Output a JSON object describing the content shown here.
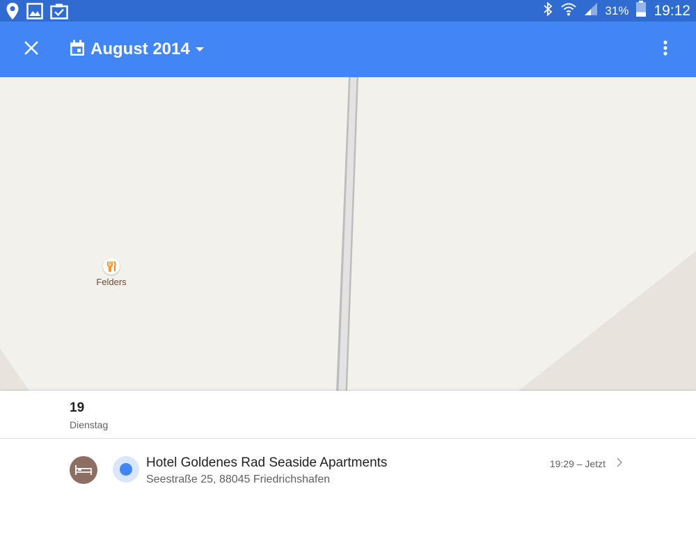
{
  "status_bar": {
    "battery_percent": "31%",
    "time": "19:12",
    "left_icons": [
      "location-pin-icon",
      "gallery-icon",
      "clipboard-check-icon"
    ],
    "right_icons": [
      "bluetooth-icon",
      "wifi-icon",
      "signal-icon",
      "battery-icon"
    ],
    "battery_level": 0.31
  },
  "app_bar": {
    "title": "August 2014",
    "close_icon": "close-icon",
    "calendar_icon": "calendar-icon",
    "dropdown_icon": "dropdown-arrow-icon",
    "menu_icon": "more-vert-icon",
    "background": "#4285f4"
  },
  "map": {
    "poi": {
      "label": "Felders",
      "icon": "restaurant-icon"
    },
    "background": "#f2f1eb"
  },
  "day": {
    "number": "19",
    "weekday": "Dienstag"
  },
  "timeline": [
    {
      "name": "Hotel Goldenes Rad Seaside Apartments",
      "address": "Seestraße 25, 88045 Friedrichshafen",
      "time": "19:29 – Jetzt",
      "avatar_icon": "hotel-bed-icon",
      "avatar_color": "#8d6e63",
      "dot_color": "#4285f4"
    }
  ]
}
